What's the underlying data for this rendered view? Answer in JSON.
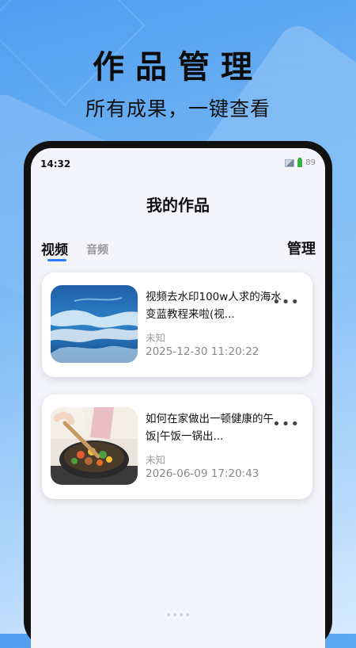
{
  "hero": {
    "title": "作品管理",
    "subtitle": "所有成果，一键查看"
  },
  "status_bar": {
    "time": "14:32",
    "battery": "89"
  },
  "page": {
    "title": "我的作品"
  },
  "tabs": [
    {
      "label": "视频",
      "active": true
    },
    {
      "label": "音频",
      "active": false
    }
  ],
  "manage_label": "管理",
  "works": [
    {
      "title": "视频去水印100w人求的海水变蓝教程来啦(视...",
      "meta": "未知",
      "time": "2025-12-30 11:20:22",
      "more": "•••",
      "thumb": "ocean-wave-image"
    },
    {
      "title": "如何在家做出一顿健康的午饭|午饭一锅出...",
      "meta": "未知",
      "time": "2026-06-09 17:20:43",
      "more": "•••",
      "thumb": "cooking-pan-image"
    }
  ],
  "colors": {
    "accent": "#2f7cf6",
    "background_top": "#4f9ef0",
    "background_bottom": "#d6eafe"
  }
}
